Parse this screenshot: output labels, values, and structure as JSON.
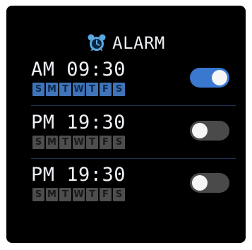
{
  "header": {
    "title": "ALARM",
    "icon": "alarm-clock-icon",
    "icon_color": "#5aa8e0"
  },
  "alarms": [
    {
      "period": "AM",
      "time": "09:30",
      "enabled": true,
      "days": [
        {
          "label": "S",
          "active": true
        },
        {
          "label": "M",
          "active": true
        },
        {
          "label": "T",
          "active": true
        },
        {
          "label": "W",
          "active": true
        },
        {
          "label": "T",
          "active": true
        },
        {
          "label": "F",
          "active": true
        },
        {
          "label": "S",
          "active": true
        }
      ]
    },
    {
      "period": "PM",
      "time": "19:30",
      "enabled": false,
      "days": [
        {
          "label": "S",
          "active": false
        },
        {
          "label": "M",
          "active": false
        },
        {
          "label": "T",
          "active": false
        },
        {
          "label": "W",
          "active": false
        },
        {
          "label": "T",
          "active": false
        },
        {
          "label": "F",
          "active": false
        },
        {
          "label": "S",
          "active": false
        }
      ]
    },
    {
      "period": "PM",
      "time": "19:30",
      "enabled": false,
      "days": [
        {
          "label": "S",
          "active": false
        },
        {
          "label": "M",
          "active": false
        },
        {
          "label": "T",
          "active": false
        },
        {
          "label": "W",
          "active": false
        },
        {
          "label": "T",
          "active": false
        },
        {
          "label": "F",
          "active": false
        },
        {
          "label": "S",
          "active": false
        }
      ]
    }
  ],
  "colors": {
    "background": "#000000",
    "accent": "#3a78d0",
    "day_active": "#3f74b8",
    "day_inactive": "#4d4d4d",
    "toggle_off": "#4a4a4a"
  }
}
